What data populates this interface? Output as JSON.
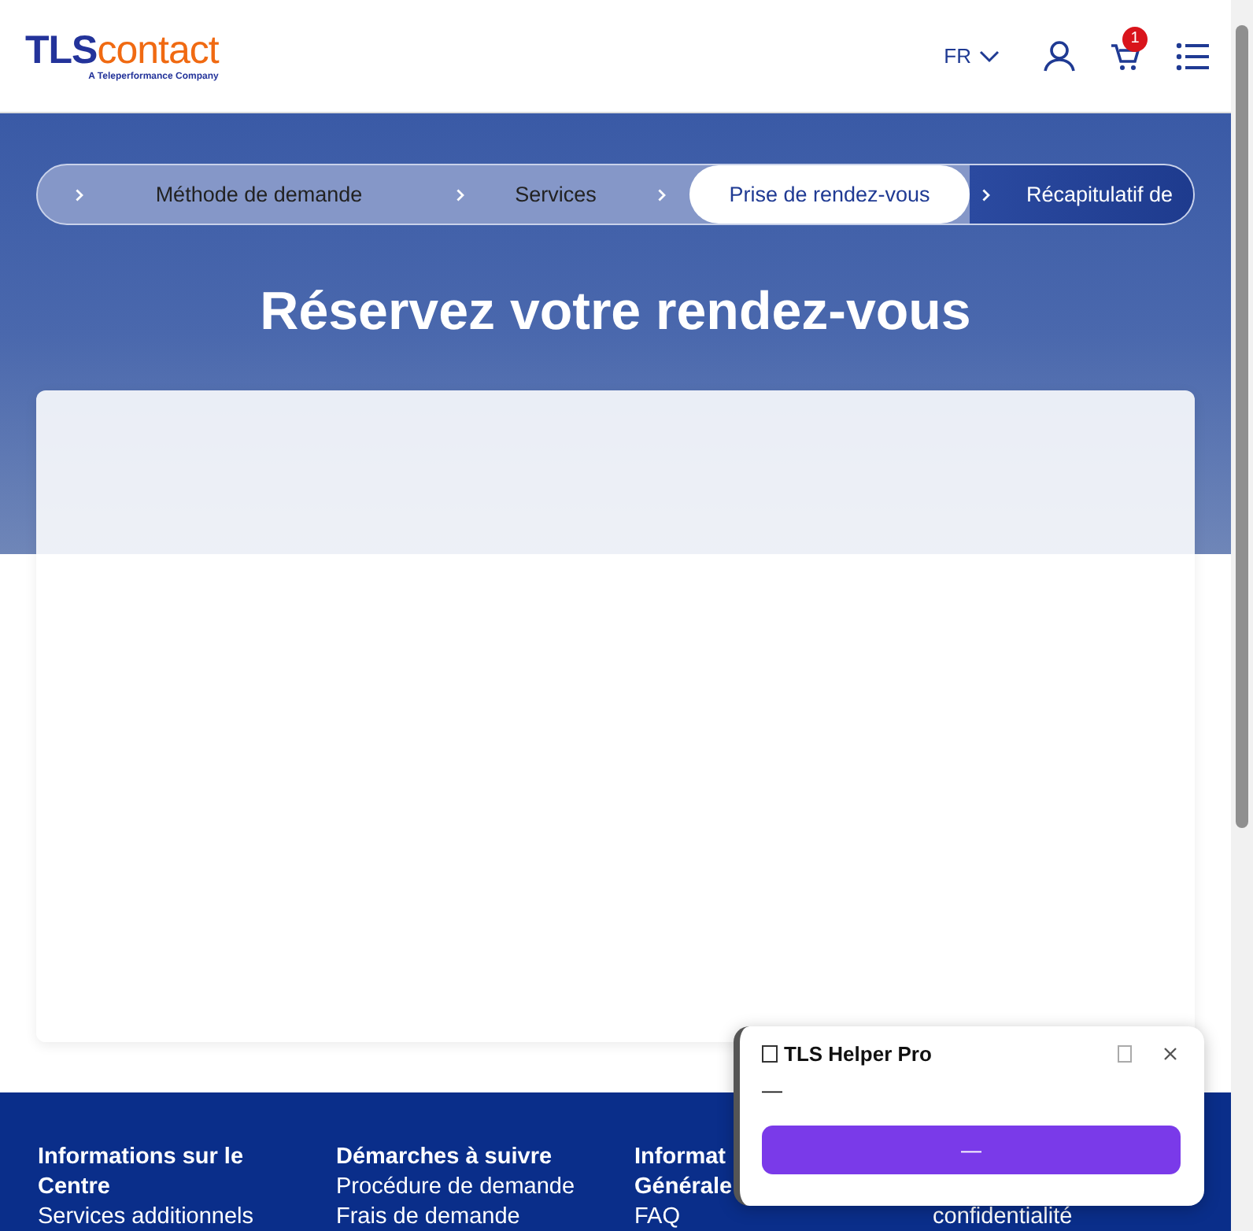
{
  "header": {
    "logo": {
      "brand_main": "TLS",
      "brand_accent": "contact",
      "tagline": "A Teleperformance Company"
    },
    "language": "FR",
    "cart_count": "1"
  },
  "stepper": [
    {
      "label": "Méthode de demande",
      "selected": false
    },
    {
      "label": "Services",
      "selected": false
    },
    {
      "label": "Prise de rendez-vous",
      "selected": true
    },
    {
      "label": "Récapitulatif de",
      "selected": false
    }
  ],
  "hero": {
    "title": "Réservez votre rendez-vous"
  },
  "footer": {
    "columns": [
      {
        "heading": [
          "Informations sur le",
          "Centre"
        ],
        "links": [
          "Services additionnels"
        ]
      },
      {
        "heading": [
          "Démarches à suivre"
        ],
        "links": [
          "Procédure de demande",
          "Frais de demande"
        ]
      },
      {
        "heading": [
          "Informat",
          "Générale"
        ],
        "links": [
          "FAQ"
        ]
      },
      {
        "links": [
          "confidentialité"
        ]
      }
    ]
  },
  "helper_popup": {
    "title": "TLS Helper Pro",
    "body": "—",
    "button": "—"
  }
}
